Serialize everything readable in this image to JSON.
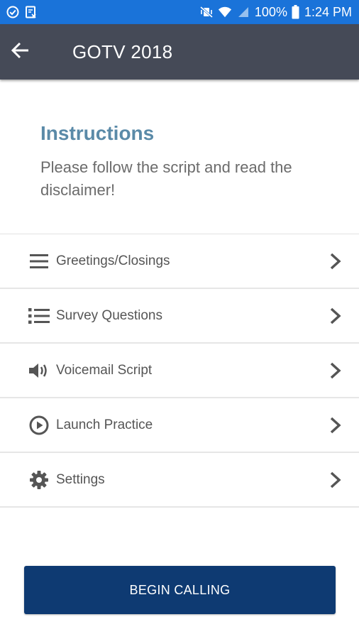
{
  "status_bar": {
    "battery": "100%",
    "time": "1:24 PM",
    "icons": [
      "check-circle-icon",
      "text-message-icon",
      "vibrate-mute-icon",
      "wifi-icon",
      "cell-signal-icon",
      "battery-icon"
    ]
  },
  "app_bar": {
    "title": "GOTV 2018",
    "back_icon": "arrow-left-icon"
  },
  "instructions": {
    "heading": "Instructions",
    "body": "Please follow the script and read the disclaimer!"
  },
  "menu": {
    "items": [
      {
        "label": "Greetings/Closings",
        "icon": "menu-lines-icon"
      },
      {
        "label": "Survey Questions",
        "icon": "list-bullets-icon"
      },
      {
        "label": "Voicemail Script",
        "icon": "speaker-icon"
      },
      {
        "label": "Launch Practice",
        "icon": "play-circle-icon"
      },
      {
        "label": "Settings",
        "icon": "gear-icon"
      }
    ]
  },
  "begin_button": {
    "label": "BEGIN CALLING"
  },
  "colors": {
    "status_bar": "#1a73d9",
    "app_bar": "#454a57",
    "heading": "#5a8aa8",
    "button": "#0e3a72"
  }
}
